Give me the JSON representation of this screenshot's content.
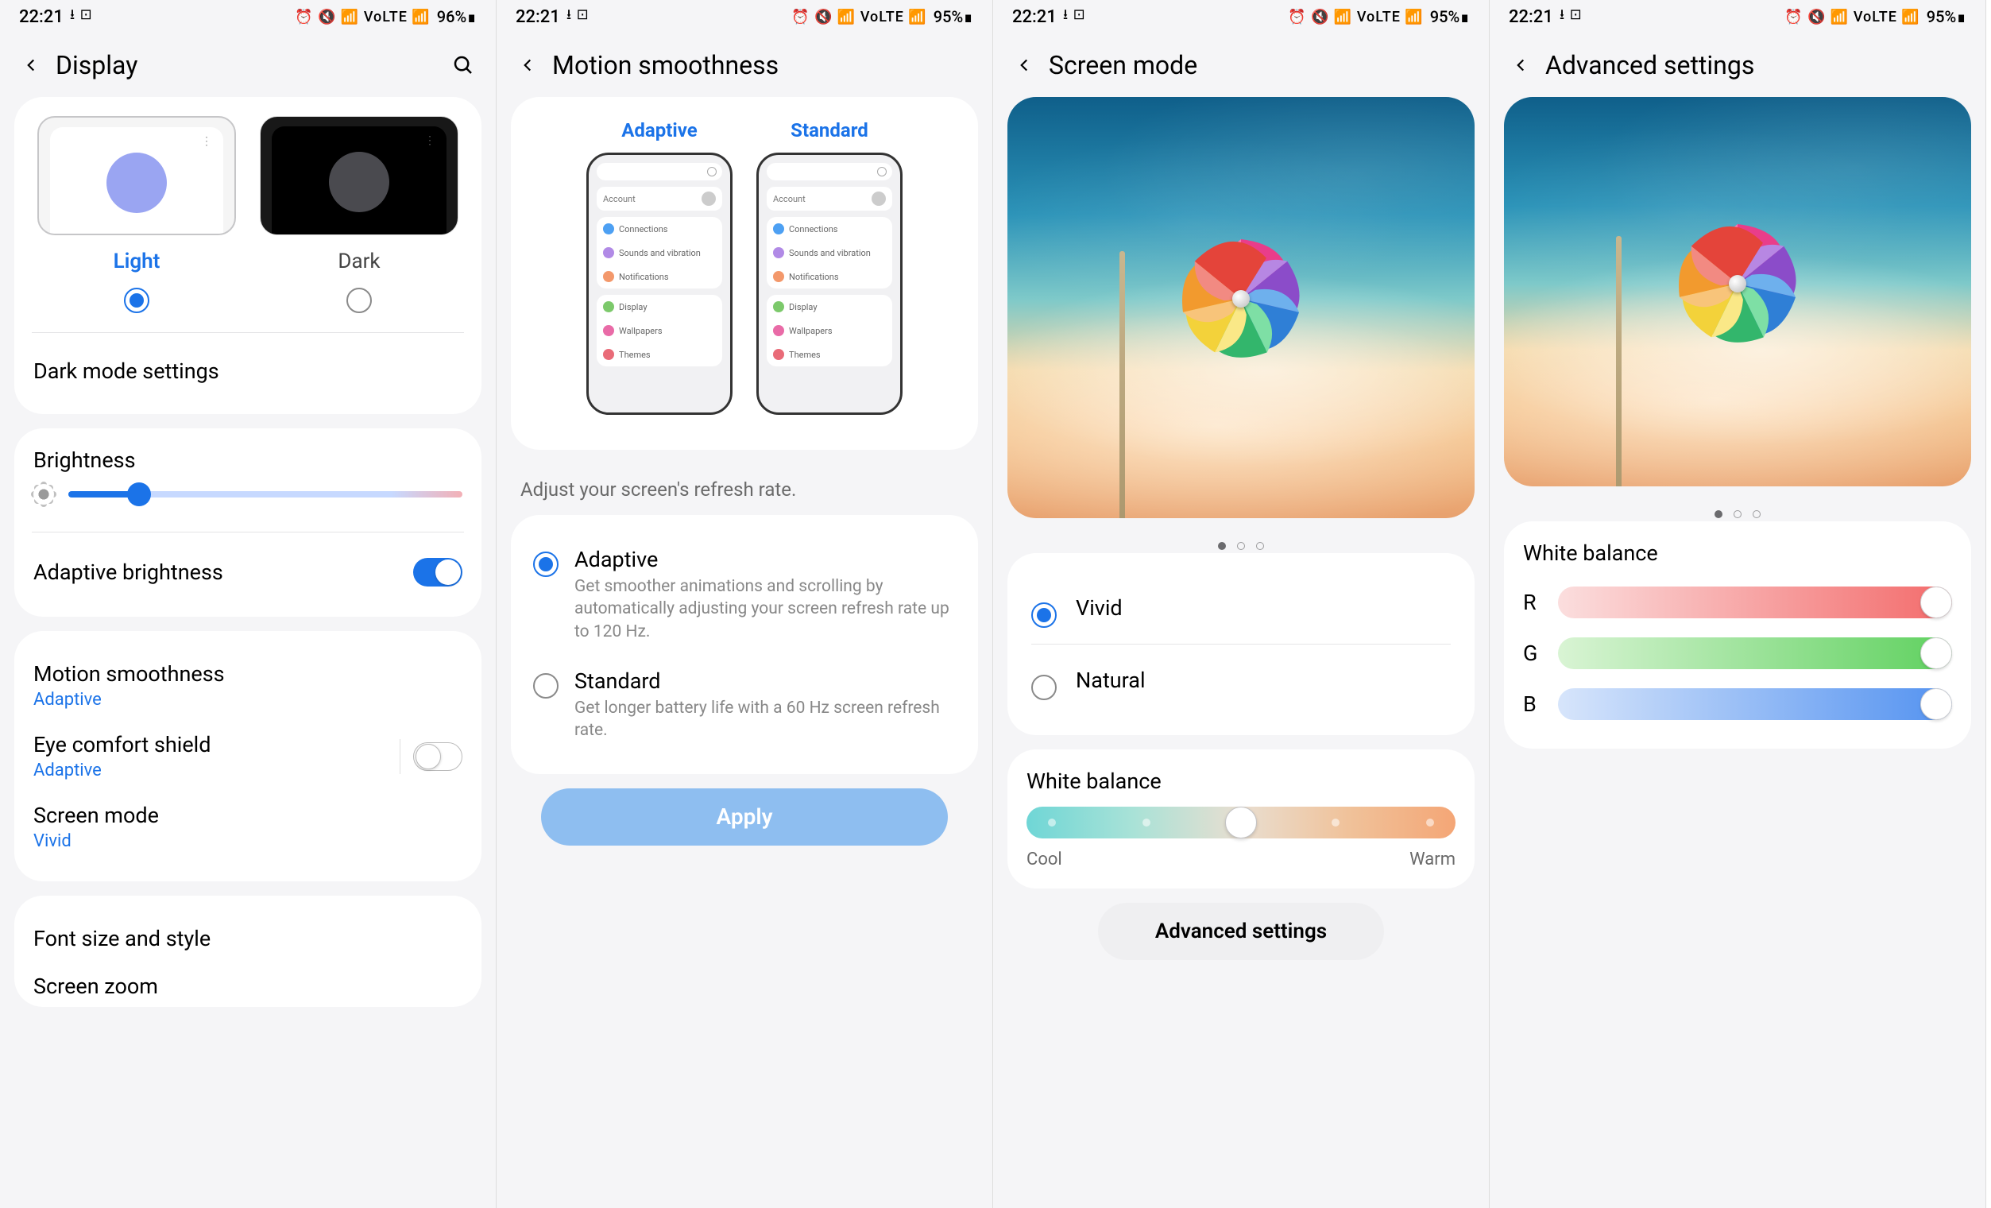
{
  "status": {
    "time": "22:21",
    "left_icons": "⭳ ⊡",
    "right_icons": "⏰ 🔇 📶 VoLTE 📶",
    "panel1_battery": "96%",
    "panels_battery": "95%"
  },
  "panel1": {
    "title": "Display",
    "theme": {
      "light": "Light",
      "dark": "Dark",
      "selected": "light"
    },
    "dark_mode_settings": "Dark mode settings",
    "brightness_label": "Brightness",
    "brightness_value": 18,
    "adaptive_brightness": "Adaptive brightness",
    "motion_smoothness": {
      "title": "Motion smoothness",
      "value": "Adaptive"
    },
    "eye_comfort": {
      "title": "Eye comfort shield",
      "value": "Adaptive"
    },
    "screen_mode": {
      "title": "Screen mode",
      "value": "Vivid"
    },
    "font_size": "Font size and style",
    "screen_zoom": "Screen zoom"
  },
  "panel2": {
    "title": "Motion smoothness",
    "preview_adaptive": "Adaptive",
    "preview_standard": "Standard",
    "preview_items": {
      "account": "Account",
      "connections": "Connections",
      "sounds": "Sounds and vibration",
      "notifications": "Notifications",
      "display": "Display",
      "wallpapers": "Wallpapers",
      "themes": "Themes"
    },
    "description": "Adjust your screen's refresh rate.",
    "options": {
      "adaptive": {
        "title": "Adaptive",
        "desc": "Get smoother animations and scrolling by automatically adjusting your screen refresh rate up to 120 Hz."
      },
      "standard": {
        "title": "Standard",
        "desc": "Get longer battery life with a 60 Hz screen refresh rate."
      }
    },
    "apply": "Apply"
  },
  "panel3": {
    "title": "Screen mode",
    "vivid": "Vivid",
    "natural": "Natural",
    "white_balance": "White balance",
    "cool": "Cool",
    "warm": "Warm",
    "wb_value": 50,
    "advanced": "Advanced settings"
  },
  "panel4": {
    "title": "Advanced settings",
    "white_balance": "White balance",
    "r": "R",
    "g": "G",
    "b": "B",
    "r_val": 100,
    "g_val": 100,
    "b_val": 100
  }
}
